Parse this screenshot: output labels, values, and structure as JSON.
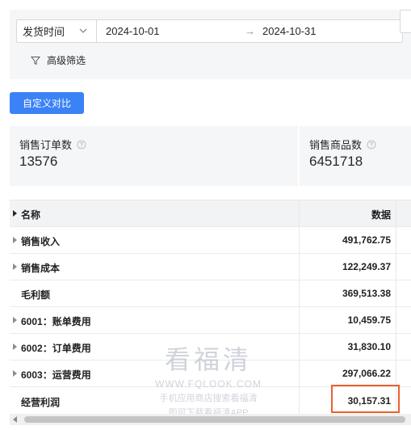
{
  "filter": {
    "field_label": "发货时间",
    "date_start": "2024-10-01",
    "date_separator": "→",
    "date_end": "2024-10-31",
    "advanced_label": "高级筛选"
  },
  "toolbar": {
    "custom_compare_label": "自定义对比"
  },
  "stats": [
    {
      "label": "销售订单数",
      "value": "13576"
    },
    {
      "label": "销售商品数",
      "value": "6451718"
    }
  ],
  "table": {
    "header": {
      "name": "名称",
      "value": "数据"
    },
    "rows": [
      {
        "name": "销售收入",
        "value": "491,762.75",
        "expandable": true
      },
      {
        "name": "销售成本",
        "value": "122,249.37",
        "expandable": true
      },
      {
        "name": "毛利额",
        "value": "369,513.38",
        "expandable": false
      },
      {
        "name": "6001：账单费用",
        "value": "10,459.75",
        "expandable": true
      },
      {
        "name": "6002：订单费用",
        "value": "31,830.10",
        "expandable": true
      },
      {
        "name": "6003：运营费用",
        "value": "297,066.22",
        "expandable": true
      },
      {
        "name": "经营利润",
        "value": "30,157.31",
        "expandable": false
      }
    ]
  },
  "watermark": {
    "title": "看福清",
    "url": "WWW.FQLOOK.COM",
    "line1": "手机应用商店搜索看福清",
    "line2": "即可下载看福清APP"
  },
  "colors": {
    "accent": "#3b82f6",
    "highlight": "#e8612c"
  }
}
